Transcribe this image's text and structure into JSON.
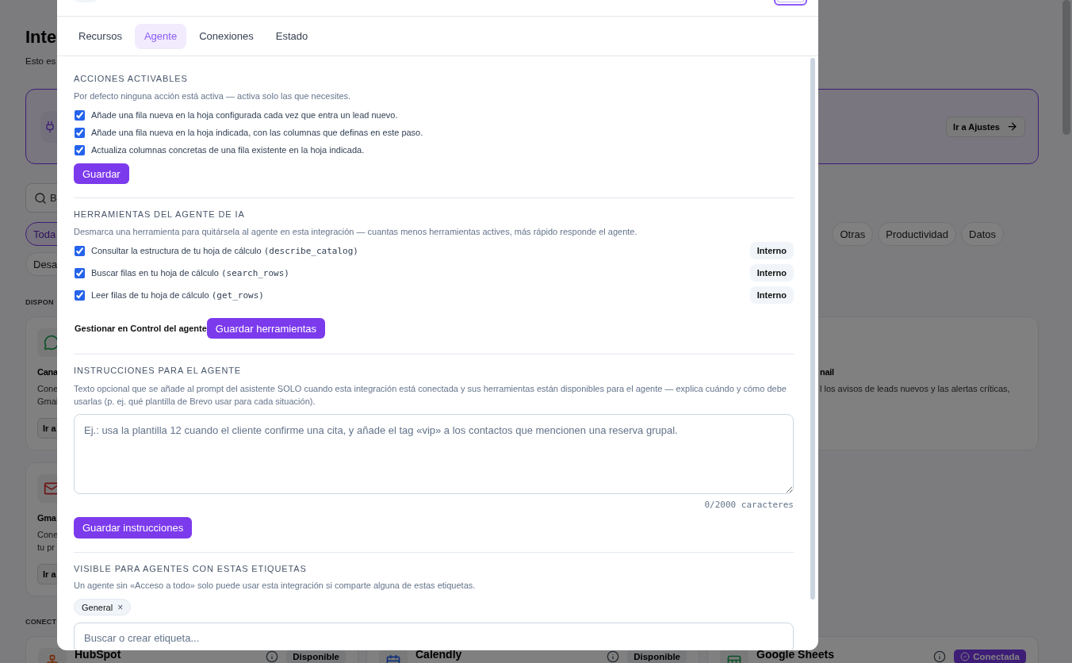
{
  "page": {
    "title": "Inte",
    "subtitle": "Esto es",
    "banner": {
      "button": "Ir a Ajustes"
    },
    "search": {
      "placeholder": "B"
    },
    "filter_rows": [
      {
        "start": [
          {
            "label": "Toda",
            "selected": true
          }
        ],
        "end": [
          {
            "label": "Otras",
            "selected": false
          },
          {
            "label": "Productividad",
            "selected": false
          },
          {
            "label": "Datos",
            "selected": false
          }
        ]
      },
      {
        "start": [
          {
            "label": "Desa",
            "selected": false
          }
        ],
        "end": []
      }
    ],
    "available_heading": "DISPON",
    "available_rows": [
      {
        "first": {
          "title": "Cana",
          "description": [
            "Cone",
            "Gmai"
          ],
          "button": "Ir a"
        },
        "last": {
          "title": "nail",
          "description": [
            "l los avisos de leads nuevos y las alertas críticas,"
          ]
        }
      },
      {
        "first": {
          "title": "Gma",
          "description": [
            "Cone",
            "tu pr"
          ],
          "button": "Ir a"
        }
      }
    ],
    "connected_heading": "CONECT",
    "connected_cards": [
      {
        "name": "HubSpot",
        "status": "Disponible",
        "connected": false
      },
      {
        "name": "Calendly",
        "status": "Disponible",
        "connected": false
      },
      {
        "name": "Google Sheets",
        "status": "Conectada",
        "connected": true
      }
    ]
  },
  "modal": {
    "tabs": [
      {
        "label": "Recursos",
        "selected": false
      },
      {
        "label": "Agente",
        "selected": true
      },
      {
        "label": "Conexiones",
        "selected": false
      },
      {
        "label": "Estado",
        "selected": false
      }
    ],
    "actions": {
      "heading": "ACCIONES ACTIVABLES",
      "description": "Por defecto ninguna acción está activa — activa solo las que necesites.",
      "items": [
        {
          "label": "Añade una fila nueva en la hoja configurada cada vez que entra un lead nuevo.",
          "checked": true
        },
        {
          "label": "Añade una fila nueva en la hoja indicada, con las columnas que definas en este paso.",
          "checked": true
        },
        {
          "label": "Actualiza columnas concretas de una fila existente en la hoja indicada.",
          "checked": true
        }
      ],
      "button": "Guardar"
    },
    "tools": {
      "heading": "HERRAMIENTAS DEL AGENTE DE IA",
      "description": "Desmarca una herramienta para quitársela al agente en esta integración — cuantas menos herramientas actives, más rápido responde el agente.",
      "items": [
        {
          "label": "Consultar la estructura de tu hoja de cálculo",
          "code": "(describe_catalog)",
          "checked": true,
          "badge": "Interno"
        },
        {
          "label": "Buscar filas en tu hoja de cálculo",
          "code": "(search_rows)",
          "checked": true,
          "badge": "Interno"
        },
        {
          "label": "Leer filas de tu hoja de cálculo",
          "code": "(get_rows)",
          "checked": true,
          "badge": "Interno"
        }
      ],
      "manage_label": "Gestionar en Control del agente",
      "button": "Guardar herramientas"
    },
    "instructions": {
      "heading": "INSTRUCCIONES PARA EL AGENTE",
      "description": "Texto opcional que se añade al prompt del asistente SOLO cuando esta integración está conectada y sus herramientas están disponibles para el agente — explica cuándo y cómo debe usarlas (p. ej. qué plantilla de Brevo usar para cada situación).",
      "placeholder": "Ej.: usa la plantilla 12 cuando el cliente confirme una cita, y añade el tag «vip» a los contactos que mencionen una reserva grupal.",
      "counter": "0/2000 caracteres",
      "button": "Guardar instrucciones"
    },
    "visibility": {
      "heading": "VISIBLE PARA AGENTES CON ESTAS ETIQUETAS",
      "description": "Un agente sin «Acceso a todo» solo puede usar esta integración si comparte alguna de estas etiquetas.",
      "tags": [
        {
          "label": "General",
          "remove": "×"
        }
      ],
      "search_placeholder": "Buscar o crear etiqueta..."
    }
  }
}
